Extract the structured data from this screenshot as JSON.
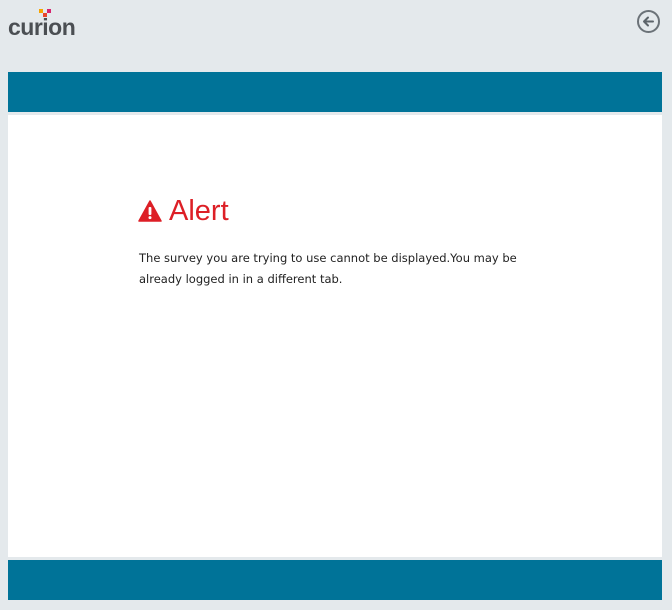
{
  "app": {
    "logo_text": "curion"
  },
  "header": {
    "back_icon": "arrow-left-circle-icon"
  },
  "alert": {
    "icon": "warning-triangle-icon",
    "title": "Alert",
    "message": "The survey you are trying to use cannot be displayed.You may be already logged in in a different tab."
  },
  "colors": {
    "accent_bar": "#007398",
    "alert_red": "#dd1f26",
    "page_background": "#e4e9ec",
    "logo_text": "#4b4f53"
  }
}
